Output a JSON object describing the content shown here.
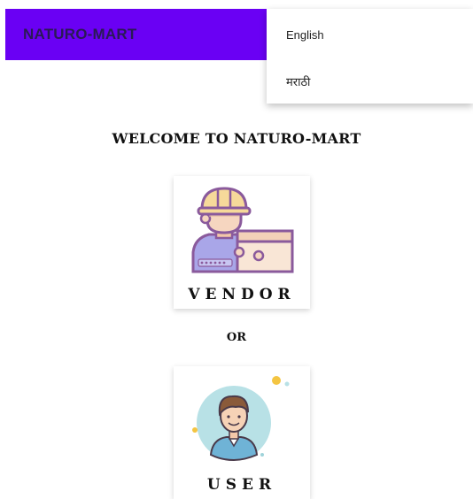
{
  "app_bar": {
    "title": "NATURO-MART",
    "color": "#6a00f4"
  },
  "language_menu": {
    "items": [
      "English",
      "मराठी"
    ]
  },
  "main": {
    "welcome": "WELCOME TO NATURO-MART",
    "vendor_label": "VENDOR",
    "or_label": "OR",
    "user_label": "USER",
    "vendor_icon": "worker-with-box-icon",
    "user_icon": "user-avatar-icon"
  }
}
